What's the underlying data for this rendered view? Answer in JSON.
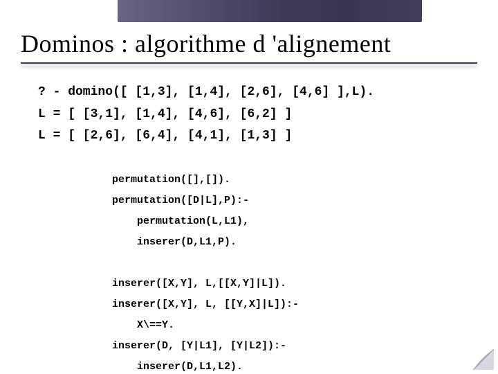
{
  "title": "Dominos : algorithme d 'alignement",
  "code_main": "? - domino([ [1,3], [1,4], [2,6], [4,6] ],L).\nL = [ [3,1], [1,4], [4,6], [6,2] ]\nL = [ [2,6], [6,4], [4,1], [1,3] ]",
  "code_inner": "permutation([],[]).\npermutation([D|L],P):-\n    permutation(L,L1),\n    inserer(D,L1,P).\n\ninserer([X,Y], L,[[X,Y]|L]).\ninserer([X,Y], L, [[Y,X]|L]):-\n    X\\==Y.\ninserer(D, [Y|L1], [Y|L2]):-\n    inserer(D,L1,L2)."
}
